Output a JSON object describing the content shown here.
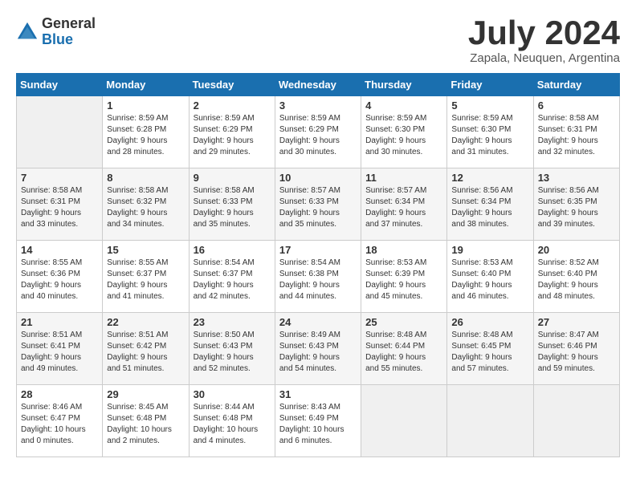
{
  "header": {
    "logo_general": "General",
    "logo_blue": "Blue",
    "month_title": "July 2024",
    "location": "Zapala, Neuquen, Argentina"
  },
  "calendar": {
    "days_of_week": [
      "Sunday",
      "Monday",
      "Tuesday",
      "Wednesday",
      "Thursday",
      "Friday",
      "Saturday"
    ],
    "weeks": [
      [
        {
          "day": "",
          "info": ""
        },
        {
          "day": "1",
          "info": "Sunrise: 8:59 AM\nSunset: 6:28 PM\nDaylight: 9 hours\nand 28 minutes."
        },
        {
          "day": "2",
          "info": "Sunrise: 8:59 AM\nSunset: 6:29 PM\nDaylight: 9 hours\nand 29 minutes."
        },
        {
          "day": "3",
          "info": "Sunrise: 8:59 AM\nSunset: 6:29 PM\nDaylight: 9 hours\nand 30 minutes."
        },
        {
          "day": "4",
          "info": "Sunrise: 8:59 AM\nSunset: 6:30 PM\nDaylight: 9 hours\nand 30 minutes."
        },
        {
          "day": "5",
          "info": "Sunrise: 8:59 AM\nSunset: 6:30 PM\nDaylight: 9 hours\nand 31 minutes."
        },
        {
          "day": "6",
          "info": "Sunrise: 8:58 AM\nSunset: 6:31 PM\nDaylight: 9 hours\nand 32 minutes."
        }
      ],
      [
        {
          "day": "7",
          "info": "Sunrise: 8:58 AM\nSunset: 6:31 PM\nDaylight: 9 hours\nand 33 minutes."
        },
        {
          "day": "8",
          "info": "Sunrise: 8:58 AM\nSunset: 6:32 PM\nDaylight: 9 hours\nand 34 minutes."
        },
        {
          "day": "9",
          "info": "Sunrise: 8:58 AM\nSunset: 6:33 PM\nDaylight: 9 hours\nand 35 minutes."
        },
        {
          "day": "10",
          "info": "Sunrise: 8:57 AM\nSunset: 6:33 PM\nDaylight: 9 hours\nand 35 minutes."
        },
        {
          "day": "11",
          "info": "Sunrise: 8:57 AM\nSunset: 6:34 PM\nDaylight: 9 hours\nand 37 minutes."
        },
        {
          "day": "12",
          "info": "Sunrise: 8:56 AM\nSunset: 6:34 PM\nDaylight: 9 hours\nand 38 minutes."
        },
        {
          "day": "13",
          "info": "Sunrise: 8:56 AM\nSunset: 6:35 PM\nDaylight: 9 hours\nand 39 minutes."
        }
      ],
      [
        {
          "day": "14",
          "info": "Sunrise: 8:55 AM\nSunset: 6:36 PM\nDaylight: 9 hours\nand 40 minutes."
        },
        {
          "day": "15",
          "info": "Sunrise: 8:55 AM\nSunset: 6:37 PM\nDaylight: 9 hours\nand 41 minutes."
        },
        {
          "day": "16",
          "info": "Sunrise: 8:54 AM\nSunset: 6:37 PM\nDaylight: 9 hours\nand 42 minutes."
        },
        {
          "day": "17",
          "info": "Sunrise: 8:54 AM\nSunset: 6:38 PM\nDaylight: 9 hours\nand 44 minutes."
        },
        {
          "day": "18",
          "info": "Sunrise: 8:53 AM\nSunset: 6:39 PM\nDaylight: 9 hours\nand 45 minutes."
        },
        {
          "day": "19",
          "info": "Sunrise: 8:53 AM\nSunset: 6:40 PM\nDaylight: 9 hours\nand 46 minutes."
        },
        {
          "day": "20",
          "info": "Sunrise: 8:52 AM\nSunset: 6:40 PM\nDaylight: 9 hours\nand 48 minutes."
        }
      ],
      [
        {
          "day": "21",
          "info": "Sunrise: 8:51 AM\nSunset: 6:41 PM\nDaylight: 9 hours\nand 49 minutes."
        },
        {
          "day": "22",
          "info": "Sunrise: 8:51 AM\nSunset: 6:42 PM\nDaylight: 9 hours\nand 51 minutes."
        },
        {
          "day": "23",
          "info": "Sunrise: 8:50 AM\nSunset: 6:43 PM\nDaylight: 9 hours\nand 52 minutes."
        },
        {
          "day": "24",
          "info": "Sunrise: 8:49 AM\nSunset: 6:43 PM\nDaylight: 9 hours\nand 54 minutes."
        },
        {
          "day": "25",
          "info": "Sunrise: 8:48 AM\nSunset: 6:44 PM\nDaylight: 9 hours\nand 55 minutes."
        },
        {
          "day": "26",
          "info": "Sunrise: 8:48 AM\nSunset: 6:45 PM\nDaylight: 9 hours\nand 57 minutes."
        },
        {
          "day": "27",
          "info": "Sunrise: 8:47 AM\nSunset: 6:46 PM\nDaylight: 9 hours\nand 59 minutes."
        }
      ],
      [
        {
          "day": "28",
          "info": "Sunrise: 8:46 AM\nSunset: 6:47 PM\nDaylight: 10 hours\nand 0 minutes."
        },
        {
          "day": "29",
          "info": "Sunrise: 8:45 AM\nSunset: 6:48 PM\nDaylight: 10 hours\nand 2 minutes."
        },
        {
          "day": "30",
          "info": "Sunrise: 8:44 AM\nSunset: 6:48 PM\nDaylight: 10 hours\nand 4 minutes."
        },
        {
          "day": "31",
          "info": "Sunrise: 8:43 AM\nSunset: 6:49 PM\nDaylight: 10 hours\nand 6 minutes."
        },
        {
          "day": "",
          "info": ""
        },
        {
          "day": "",
          "info": ""
        },
        {
          "day": "",
          "info": ""
        }
      ]
    ]
  }
}
